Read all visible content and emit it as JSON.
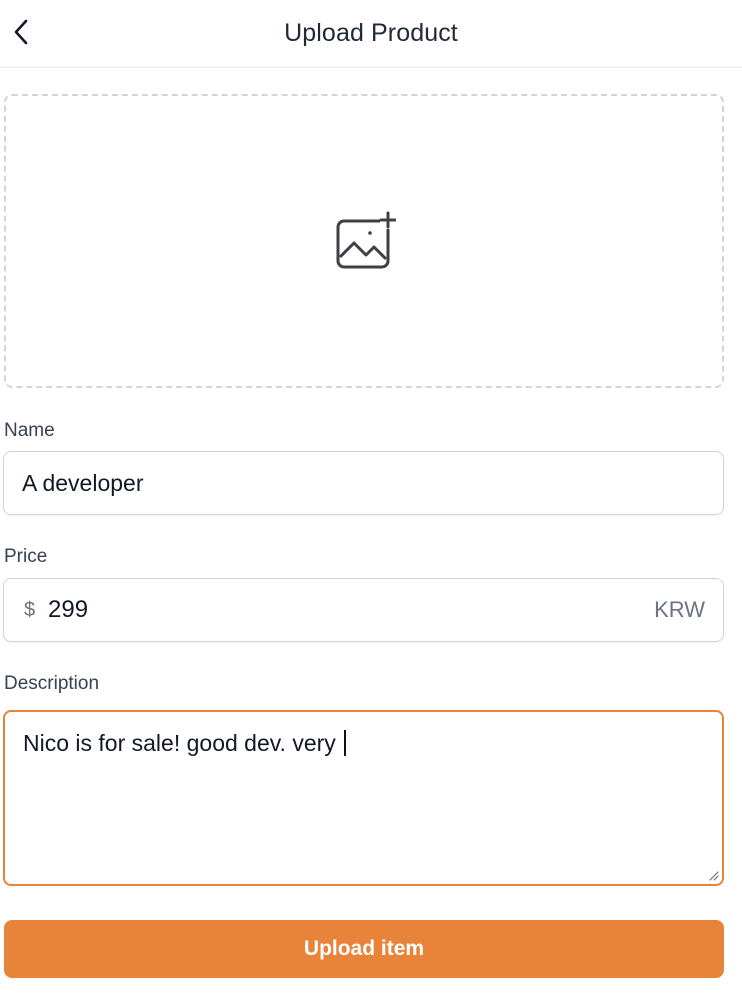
{
  "header": {
    "back_icon": "chevron-left-icon",
    "title": "Upload Product"
  },
  "photo_upload": {
    "icon": "image-add-icon"
  },
  "form": {
    "name": {
      "label": "Name",
      "value": "A developer"
    },
    "price": {
      "label": "Price",
      "prefix": "$",
      "value": "299",
      "suffix": "KRW"
    },
    "description": {
      "label": "Description",
      "value": "Nico is for sale! good dev. very "
    }
  },
  "submit": {
    "label": "Upload item"
  },
  "colors": {
    "accent": "#e8833a",
    "border": "#d1d5db"
  }
}
